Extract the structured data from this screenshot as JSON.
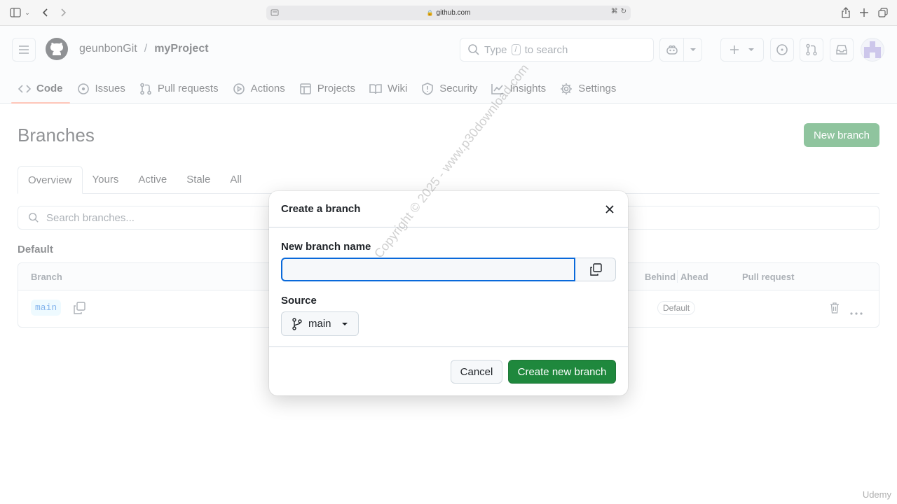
{
  "browser": {
    "url": "github.com"
  },
  "header": {
    "owner": "geunbonGit",
    "separator": "/",
    "repo": "myProject",
    "search": {
      "prefix": "Type",
      "key": "/",
      "suffix": "to search"
    }
  },
  "nav": [
    {
      "label": "Code",
      "icon": "code-icon",
      "active": true
    },
    {
      "label": "Issues",
      "icon": "issue-icon"
    },
    {
      "label": "Pull requests",
      "icon": "pull-request-icon"
    },
    {
      "label": "Actions",
      "icon": "play-icon"
    },
    {
      "label": "Projects",
      "icon": "table-icon"
    },
    {
      "label": "Wiki",
      "icon": "book-icon"
    },
    {
      "label": "Security",
      "icon": "shield-icon"
    },
    {
      "label": "Insights",
      "icon": "graph-icon"
    },
    {
      "label": "Settings",
      "icon": "gear-icon"
    }
  ],
  "page": {
    "title": "Branches",
    "new_branch_label": "New branch",
    "tabs": [
      "Overview",
      "Yours",
      "Active",
      "Stale",
      "All"
    ],
    "search_placeholder": "Search branches...",
    "section": "Default",
    "columns": {
      "branch": "Branch",
      "behind": "Behind",
      "ahead": "Ahead",
      "pull_request": "Pull request"
    },
    "row": {
      "branch": "main",
      "badge": "Default"
    }
  },
  "modal": {
    "title": "Create a branch",
    "name_label": "New branch name",
    "name_value": "",
    "source_label": "Source",
    "source_value": "main",
    "cancel_label": "Cancel",
    "create_label": "Create new branch"
  },
  "watermark": "Copyright © 2025 - www.p30download.com",
  "brand": "Udemy",
  "colors": {
    "primary_green": "#1f883d",
    "focus_blue": "#0969da",
    "active_underline": "#fd8c73"
  }
}
